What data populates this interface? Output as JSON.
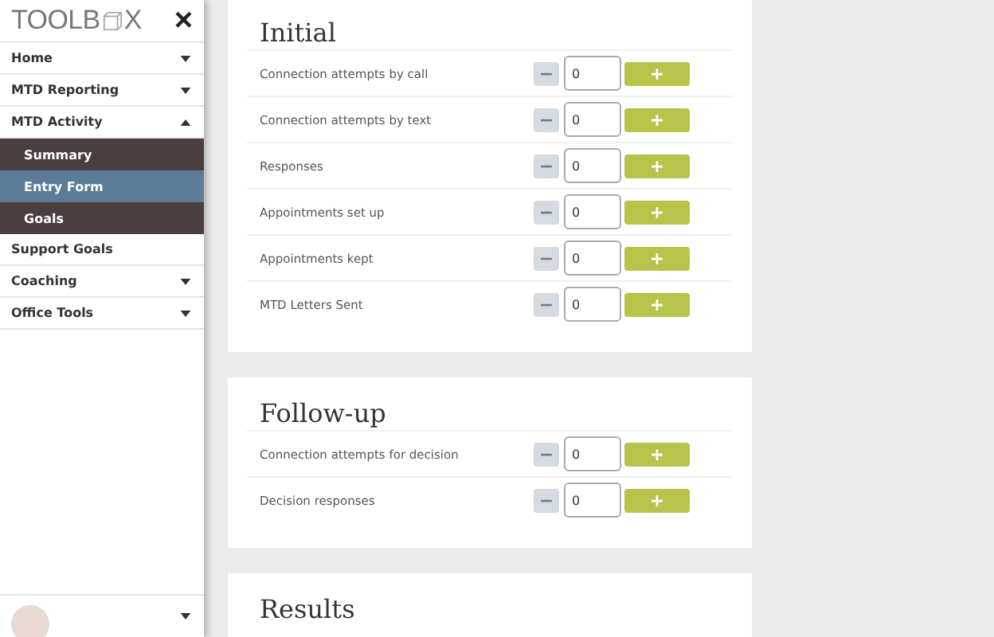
{
  "sidebar": {
    "logo_parts": [
      "TOOLB",
      "X"
    ],
    "close": "×",
    "items": [
      {
        "label": "Home",
        "expanded": false
      },
      {
        "label": "MTD Reporting",
        "expanded": false
      },
      {
        "label": "MTD Activity",
        "expanded": true,
        "children": [
          {
            "label": "Summary",
            "selected": false
          },
          {
            "label": "Entry Form",
            "selected": true
          },
          {
            "label": "Goals",
            "selected": false
          }
        ]
      },
      {
        "label": "Support Goals"
      },
      {
        "label": "Coaching",
        "expanded": false
      },
      {
        "label": "Office Tools",
        "expanded": false
      }
    ]
  },
  "stepper": {
    "minus": "−",
    "plus": "+"
  },
  "sections": [
    {
      "title": "Initial",
      "rows": [
        {
          "label": "Connection attempts by call",
          "value": "0",
          "minus_disabled": true
        },
        {
          "label": "Connection attempts by text",
          "value": "0",
          "minus_disabled": true
        },
        {
          "label": "Responses",
          "value": "0",
          "minus_disabled": true
        },
        {
          "label": "Appointments set up",
          "value": "0",
          "minus_disabled": true
        },
        {
          "label": "Appointments kept",
          "value": "0",
          "minus_disabled": true
        },
        {
          "label": "MTD Letters Sent",
          "value": "0",
          "minus_disabled": true
        }
      ]
    },
    {
      "title": "Follow-up",
      "rows": [
        {
          "label": "Connection attempts for decision",
          "value": "0",
          "minus_disabled": true
        },
        {
          "label": "Decision responses",
          "value": "0",
          "minus_disabled": true
        }
      ]
    },
    {
      "title": "Results"
    }
  ]
}
